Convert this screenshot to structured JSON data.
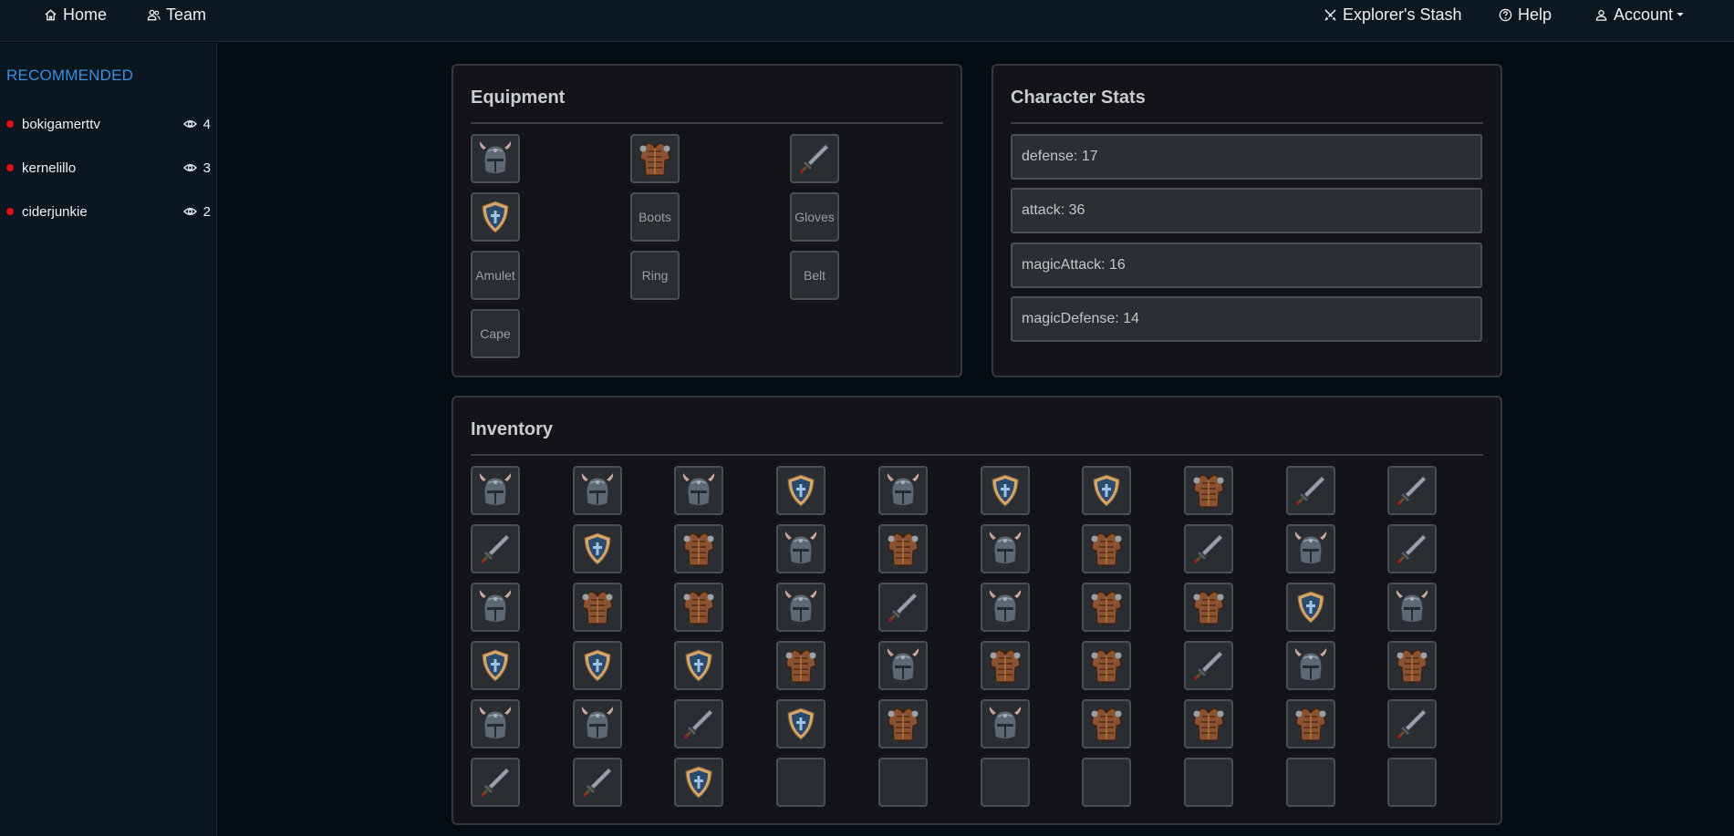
{
  "nav": {
    "home": "Home",
    "team": "Team",
    "stash": "Explorer's Stash",
    "help": "Help",
    "account": "Account"
  },
  "sidebar": {
    "title": "RECOMMENDED",
    "streamers": [
      {
        "name": "bokigamerttv",
        "viewers": "4"
      },
      {
        "name": "kernelillo",
        "viewers": "3"
      },
      {
        "name": "ciderjunkie",
        "viewers": "2"
      }
    ]
  },
  "equipment": {
    "title": "Equipment",
    "slots": [
      {
        "item": "helmet",
        "label": ""
      },
      {
        "item": "armor",
        "label": ""
      },
      {
        "item": "sword",
        "label": ""
      },
      {
        "item": "shield",
        "label": ""
      },
      {
        "item": "",
        "label": "Boots"
      },
      {
        "item": "",
        "label": "Gloves"
      },
      {
        "item": "",
        "label": "Amulet"
      },
      {
        "item": "",
        "label": "Ring"
      },
      {
        "item": "",
        "label": "Belt"
      },
      {
        "item": "",
        "label": "Cape"
      }
    ]
  },
  "stats": {
    "title": "Character Stats",
    "items": [
      "defense: 17",
      "attack: 36",
      "magicAttack: 16",
      "magicDefense: 14"
    ]
  },
  "inventory": {
    "title": "Inventory",
    "items": [
      "helmet",
      "helmet",
      "helmet",
      "shield",
      "helmet",
      "shield",
      "shield",
      "armor",
      "sword",
      "sword",
      "sword",
      "shield",
      "armor",
      "helmet",
      "armor",
      "helmet",
      "armor",
      "sword",
      "helmet",
      "sword",
      "helmet",
      "armor",
      "armor",
      "helmet",
      "sword",
      "helmet",
      "armor",
      "armor",
      "shield",
      "helmet",
      "shield",
      "shield",
      "shield",
      "armor",
      "helmet",
      "armor",
      "armor",
      "sword",
      "helmet",
      "armor",
      "helmet",
      "helmet",
      "sword",
      "shield",
      "armor",
      "helmet",
      "armor",
      "armor",
      "armor",
      "sword",
      "sword",
      "sword",
      "shield",
      "",
      "",
      "",
      "",
      "",
      "",
      ""
    ]
  },
  "colors": {
    "accent": "#3b8ee0",
    "live": "#e0121a",
    "panel_bg": "#121417",
    "slot_bg": "#2a2d31"
  }
}
